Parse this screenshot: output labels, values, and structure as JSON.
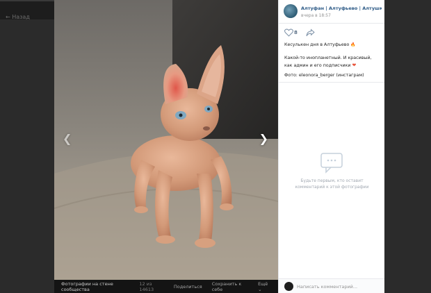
{
  "topbar": {
    "back_label": "← Назад",
    "close_icon": "close-icon"
  },
  "post": {
    "group_name": "Алтуфан | Алтуфьево | Алтушка | СВ...",
    "time": "вчера в 18:57",
    "likes": "8",
    "title": "Кесулькен дня в Алтуфьево",
    "title_emoji": "🔥",
    "body": "Какой-то инопланетный. И красивый, как админ и его подписчики",
    "body_emoji": "❤",
    "credit": "Фото: eleonora_berger (инстаграм)"
  },
  "comments": {
    "empty_message": "Будьте первым, кто оставит комментарий к этой фотографии",
    "placeholder": "Написать комментарий..."
  },
  "viewer": {
    "album": "Фотографии на стене сообщества",
    "counter": "12 из 14613",
    "share": "Поделиться",
    "save": "Сохранить к себе",
    "more": "Ещё ⌄",
    "prev_icon": "chevron-left-icon",
    "next_icon": "chevron-right-icon"
  },
  "colors": {
    "link": "#2a5885",
    "accent": "#5a6f86",
    "panel_bg": "#ffffff",
    "backdrop": "#2b2b2b"
  }
}
